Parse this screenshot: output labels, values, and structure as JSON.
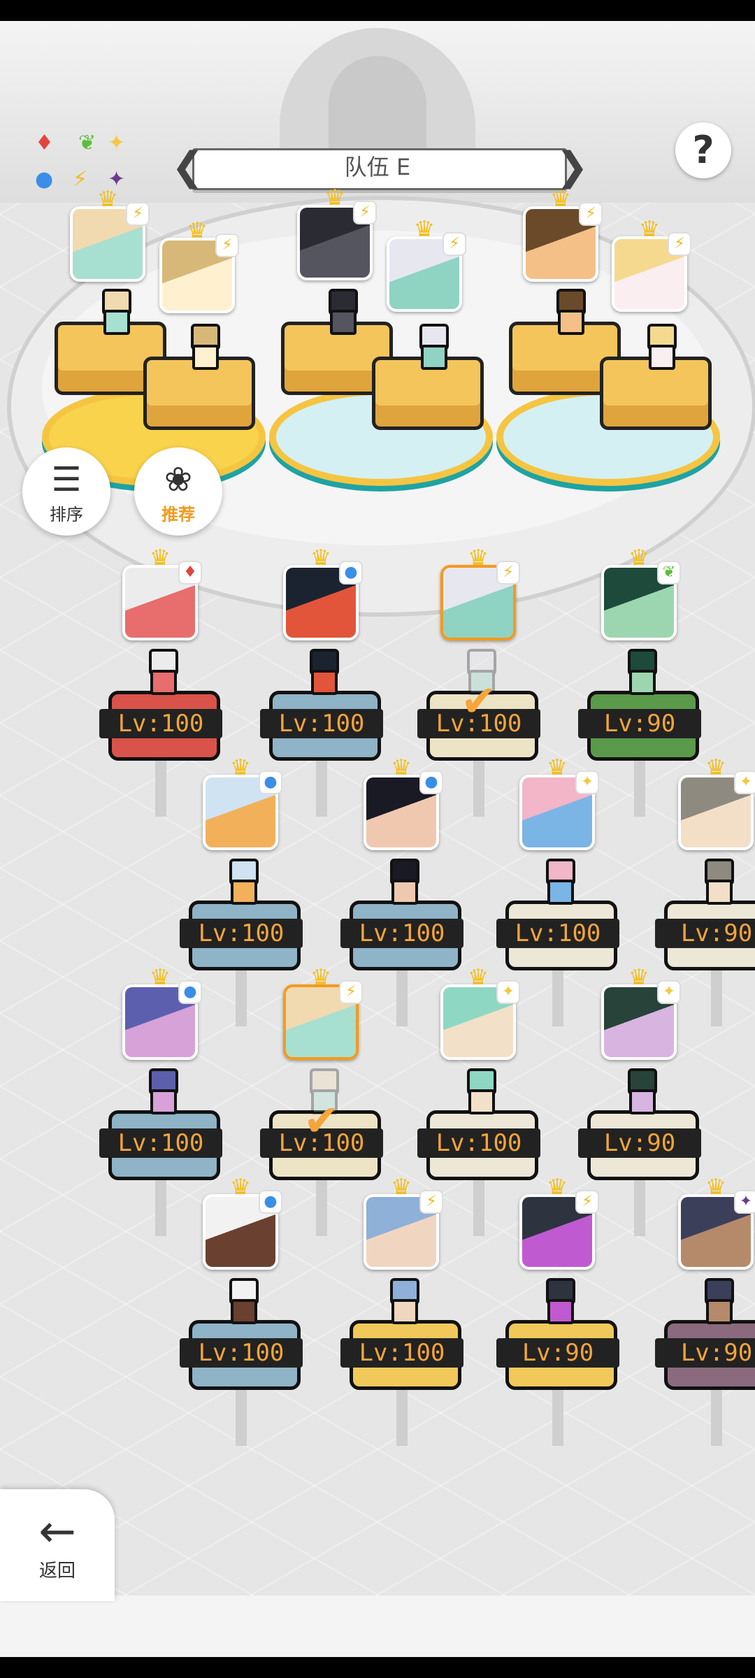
{
  "status_bar": {},
  "legend": {
    "items": [
      {
        "icon": "diamond-red-icon",
        "glyph": "♦",
        "color": "#e2453c"
      },
      {
        "icon": "leaf-green-icon",
        "glyph": "❦",
        "color": "#5bbd3e"
      },
      {
        "icon": "sparkle-yellow-icon",
        "glyph": "✦",
        "color": "#f5c842"
      },
      {
        "icon": "circle-blue-icon",
        "glyph": "●",
        "color": "#3a8ee6"
      },
      {
        "icon": "lightning-yellow-icon",
        "glyph": "⚡",
        "color": "#f5b921"
      },
      {
        "icon": "star-purple-icon",
        "glyph": "✦",
        "color": "#6a3c8c"
      }
    ]
  },
  "team_selector": {
    "title": "队伍 E",
    "prev_glyph": "❮",
    "next_glyph": "❯"
  },
  "help": {
    "glyph": "?"
  },
  "sort_button": {
    "glyph": "☰",
    "label": "排序"
  },
  "recommend_button": {
    "glyph": "❀",
    "label": "推荐"
  },
  "party": [
    {
      "element": "lightning-yellow-icon",
      "colors": [
        "#f1d9b0",
        "#a7e0d0"
      ]
    },
    {
      "element": "lightning-yellow-icon",
      "colors": [
        "#d8b878",
        "#fff1d0"
      ]
    },
    {
      "element": "lightning-yellow-icon",
      "colors": [
        "#2b2b33",
        "#55555f"
      ]
    },
    {
      "element": "lightning-yellow-icon",
      "colors": [
        "#e7e7f0",
        "#8fd3c3"
      ]
    },
    {
      "element": "lightning-yellow-icon",
      "colors": [
        "#6b4a2a",
        "#f4c088"
      ]
    },
    {
      "element": "lightning-yellow-icon",
      "colors": [
        "#f5d98f",
        "#fbeef0"
      ]
    }
  ],
  "roster": [
    {
      "level": "Lv:100",
      "element": "♦",
      "ecolor": "#e2453c",
      "ped": "#d9534a",
      "selected": false,
      "colors": [
        "#ececec",
        "#e86d6d"
      ]
    },
    {
      "level": "Lv:100",
      "element": "●",
      "ecolor": "#3a8ee6",
      "ped": "#8fb3c7",
      "selected": false,
      "colors": [
        "#1c2330",
        "#e2553a"
      ]
    },
    {
      "level": "Lv:100",
      "element": "⚡",
      "ecolor": "#f5b921",
      "ped": "#ede4c5",
      "selected": true,
      "colors": [
        "#e7e7f0",
        "#8fd3c3"
      ]
    },
    {
      "level": "Lv:90",
      "element": "❦",
      "ecolor": "#5bbd3e",
      "ped": "#5b9a4a",
      "selected": false,
      "colors": [
        "#1d4a3a",
        "#9cd6b0"
      ]
    },
    {
      "level": "Lv:100",
      "element": "●",
      "ecolor": "#3a8ee6",
      "ped": "#8fb3c7",
      "selected": false,
      "colors": [
        "#cfe3f2",
        "#f3b05b"
      ]
    },
    {
      "level": "Lv:100",
      "element": "●",
      "ecolor": "#3a8ee6",
      "ped": "#8fb3c7",
      "selected": false,
      "colors": [
        "#1a1a24",
        "#f0c8b0"
      ]
    },
    {
      "level": "Lv:100",
      "element": "✦",
      "ecolor": "#f5c842",
      "ped": "#ede7d7",
      "selected": false,
      "colors": [
        "#f3b5c8",
        "#7ab5e6"
      ]
    },
    {
      "level": "Lv:90",
      "element": "✦",
      "ecolor": "#f5c842",
      "ped": "#ede7d7",
      "selected": false,
      "colors": [
        "#8e8a80",
        "#f3dfc8"
      ]
    },
    {
      "level": "Lv:100",
      "element": "●",
      "ecolor": "#3a8ee6",
      "ped": "#8fb3c7",
      "selected": false,
      "colors": [
        "#5c5fae",
        "#d6a2d8"
      ]
    },
    {
      "level": "Lv:100",
      "element": "⚡",
      "ecolor": "#f5b921",
      "ped": "#ede4c5",
      "selected": true,
      "colors": [
        "#f1d9b0",
        "#a7e0d0"
      ]
    },
    {
      "level": "Lv:100",
      "element": "✦",
      "ecolor": "#f5c842",
      "ped": "#ede7d7",
      "selected": false,
      "colors": [
        "#8ed8c3",
        "#f3e0c8"
      ]
    },
    {
      "level": "Lv:90",
      "element": "✦",
      "ecolor": "#f5c842",
      "ped": "#ede7d7",
      "selected": false,
      "colors": [
        "#27433a",
        "#d7b5e0"
      ]
    },
    {
      "level": "Lv:100",
      "element": "●",
      "ecolor": "#3a8ee6",
      "ped": "#8fb3c7",
      "selected": false,
      "colors": [
        "#f2f2f2",
        "#6a4030"
      ]
    },
    {
      "level": "Lv:100",
      "element": "⚡",
      "ecolor": "#f5b921",
      "ped": "#f0c95a",
      "selected": false,
      "colors": [
        "#8fb0d8",
        "#f0d6c0"
      ]
    },
    {
      "level": "Lv:90",
      "element": "⚡",
      "ecolor": "#f5b921",
      "ped": "#f0c95a",
      "selected": false,
      "colors": [
        "#2e3340",
        "#c05ad0"
      ]
    },
    {
      "level": "Lv:90",
      "element": "✦",
      "ecolor": "#6a3c8c",
      "ped": "#8a6a7c",
      "selected": false,
      "colors": [
        "#3c3f5a",
        "#b58a6a"
      ]
    }
  ],
  "back_button": {
    "glyph": "←",
    "label": "返回"
  }
}
